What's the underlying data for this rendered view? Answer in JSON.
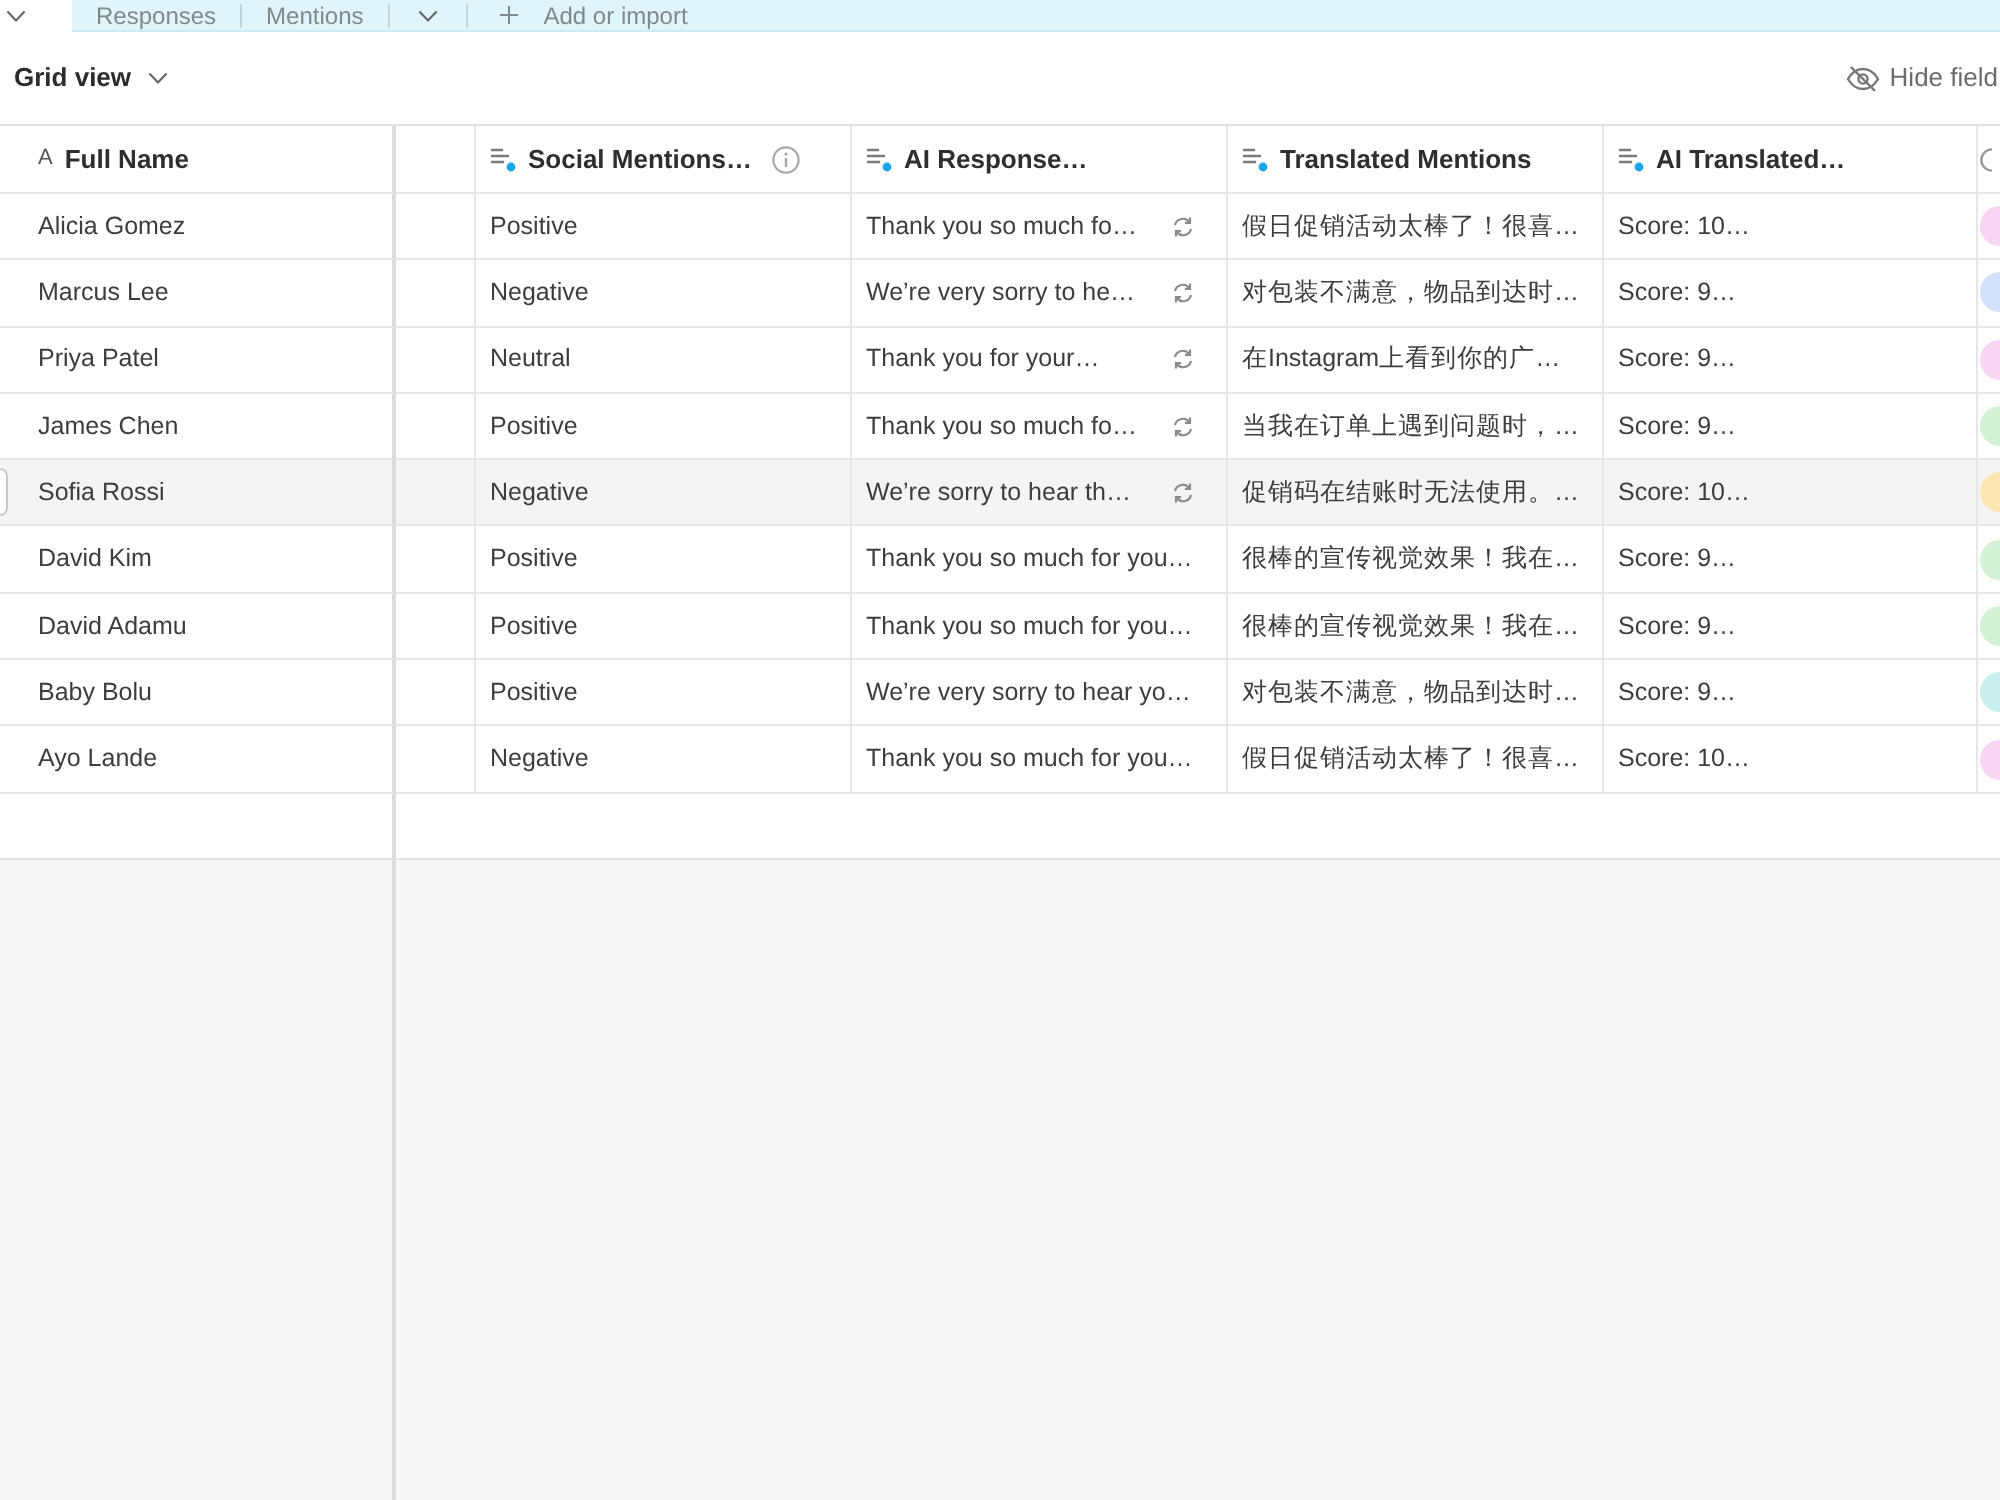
{
  "tab_bar": {
    "tabs": [
      {
        "selected": true
      },
      {
        "label": "Responses",
        "selected": false
      },
      {
        "label": "Mentions",
        "selected": false
      }
    ],
    "add_label": "Add or import"
  },
  "toolbar": {
    "view": "Grid view",
    "hide_fields": "Hide field"
  },
  "table": {
    "columns": [
      {
        "kind": "text",
        "icon": "A",
        "label": "Full Name",
        "info": false
      },
      {
        "kind": "blank",
        "info": false
      },
      {
        "kind": "ai",
        "label": "Social Mentions…",
        "info": true
      },
      {
        "kind": "ai",
        "label": "AI Response…",
        "info": false
      },
      {
        "kind": "ai",
        "label": "Translated Mentions",
        "info": false
      },
      {
        "kind": "ai",
        "label": "AI Translated…",
        "info": false
      },
      {
        "kind": "select",
        "info": false
      }
    ],
    "rows": [
      {
        "highlighted": false,
        "name": "Alicia Gomez",
        "sentiment": "Positive",
        "response": "Thank you so much fo…",
        "refresh": true,
        "translated": "假日促销活动太棒了！很喜…",
        "score": "Score: 10…",
        "color": "#f7d5f3"
      },
      {
        "highlighted": false,
        "name": "Marcus Lee",
        "sentiment": "Negative",
        "response": "We’re very sorry to he…",
        "refresh": true,
        "translated": "对包装不满意，物品到达时…",
        "score": "Score: 9…",
        "color": "#d4e0fa"
      },
      {
        "highlighted": false,
        "name": "Priya Patel",
        "sentiment": "Neutral",
        "response": "Thank you for your…",
        "refresh": true,
        "translated": "在Instagram上看到你的广…",
        "score": "Score: 9…",
        "color": "#f7d5f3"
      },
      {
        "highlighted": false,
        "name": "James Chen",
        "sentiment": "Positive",
        "response": "Thank you so much fo…",
        "refresh": true,
        "translated": "当我在订单上遇到问题时，…",
        "score": "Score: 9…",
        "color": "#d3f1d5"
      },
      {
        "highlighted": true,
        "name": "Sofia Rossi",
        "sentiment": "Negative",
        "response": "We’re sorry to hear th…",
        "refresh": true,
        "translated": "促销码在结账时无法使用。…",
        "score": "Score: 10…",
        "color": "#fce7b5"
      },
      {
        "highlighted": false,
        "name": "David Kim",
        "sentiment": "Positive",
        "response": "Thank you so much for you…",
        "refresh": false,
        "translated": "很棒的宣传视觉效果！我在…",
        "score": "Score: 9…",
        "color": "#d3f1d5"
      },
      {
        "highlighted": false,
        "name": "David Adamu",
        "sentiment": "Positive",
        "response": "Thank you so much for you…",
        "refresh": false,
        "translated": "很棒的宣传视觉效果！我在…",
        "score": "Score: 9…",
        "color": "#d3f1d5"
      },
      {
        "highlighted": false,
        "name": "Baby Bolu",
        "sentiment": "Positive",
        "response": "We’re very sorry to hear yo…",
        "refresh": false,
        "translated": "对包装不满意，物品到达时…",
        "score": "Score: 9…",
        "color": "#c9f0ea"
      },
      {
        "highlighted": false,
        "name": "Ayo Lande",
        "sentiment": "Negative",
        "response": "Thank you so much for you…",
        "refresh": false,
        "translated": "假日促销活动太棒了！很喜…",
        "score": "Score: 10…",
        "color": "#f7d5f3"
      }
    ]
  }
}
